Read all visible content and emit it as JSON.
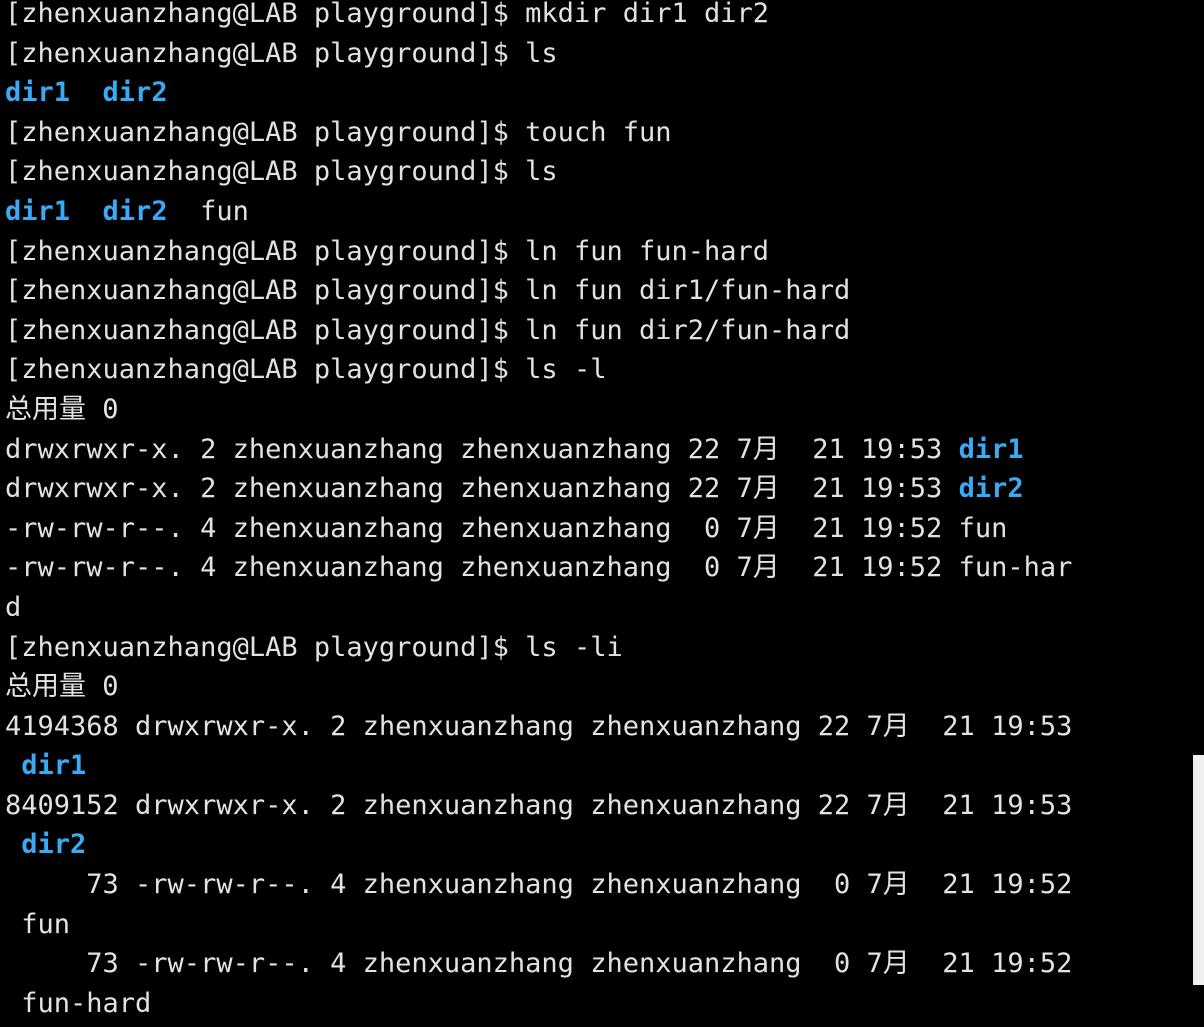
{
  "terminal": {
    "colors": {
      "background": "#000000",
      "foreground": "#e2e2e2",
      "directory": "#3aaaf4"
    },
    "prompt": "[zhenxuanzhang@LAB playground]$ ",
    "cmd_mkdir": "mkdir dir1 dir2",
    "cmd_ls": "ls",
    "cmd_touch": "touch fun",
    "cmd_ln_1": "ln fun fun-hard",
    "cmd_ln_2": "ln fun dir1/fun-hard",
    "cmd_ln_3": "ln fun dir2/fun-hard",
    "cmd_ls_l": "ls -l",
    "cmd_ls_li": "ls -li",
    "name_dir1": "dir1",
    "name_dir2": "dir2",
    "name_fun": "fun",
    "name_fun_hard": "fun-hard",
    "total_line": "总用量 0",
    "ls_sep": "  ",
    "ls_l": {
      "row_dir1_meta": "drwxrwxr-x. 2 zhenxuanzhang zhenxuanzhang 22 7月  21 19:53 ",
      "row_dir2_meta": "drwxrwxr-x. 2 zhenxuanzhang zhenxuanzhang 22 7月  21 19:53 ",
      "row_fun_meta": "-rw-rw-r--. 4 zhenxuanzhang zhenxuanzhang  0 7月  21 19:52 ",
      "row_fun_hard_meta": "-rw-rw-r--. 4 zhenxuanzhang zhenxuanzhang  0 7月  21 19:52 ",
      "row_fun_hard_name_part1": "fun-har",
      "row_fun_hard_name_part2": "d"
    },
    "ls_li": {
      "row_dir1_meta": "4194368 drwxrwxr-x. 2 zhenxuanzhang zhenxuanzhang 22 7月  21 19:53",
      "row_dir2_meta": "8409152 drwxrwxr-x. 2 zhenxuanzhang zhenxuanzhang 22 7月  21 19:53",
      "row_fun_meta": "     73 -rw-rw-r--. 4 zhenxuanzhang zhenxuanzhang  0 7月  21 19:52",
      "row_fun_hard_meta": "     73 -rw-rw-r--. 4 zhenxuanzhang zhenxuanzhang  0 7月  21 19:52",
      "wrap_indent": " "
    }
  }
}
